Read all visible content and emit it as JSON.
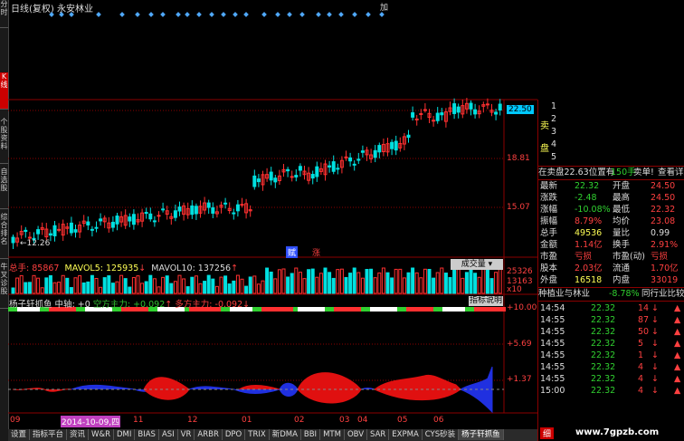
{
  "title": {
    "chart_type": "日线(复权)",
    "name": "永安林业",
    "code": ""
  },
  "topright": "加",
  "vtabs": [
    "分时",
    "K线",
    "个股资料",
    "自选股",
    "综合排名",
    "牛叉诊股"
  ],
  "price_axis": [
    "22.50",
    "18.81",
    "15.07"
  ],
  "low_label": "12.26",
  "zhang": "涨",
  "fu": "赋",
  "volume": {
    "total_label": "总手",
    "total": "85867",
    "ma5_label": "MAVOL5",
    "ma5": "125935",
    "ma10_label": "MAVOL10",
    "ma10": "137256",
    "btn": "成交量",
    "axis": [
      "25326",
      "13163",
      "x10"
    ]
  },
  "indicator": {
    "name": "杨子轩抓鱼",
    "zhongzhou_label": "中轴",
    "zhongzhou": "+0",
    "kong_label": "空方主力",
    "kong": "+0.092",
    "duo_label": "多方主力",
    "duo": "-0.092",
    "btn": "指标说明",
    "axis": [
      "+10.00",
      "+5.69",
      "+1.37"
    ]
  },
  "xaxis": [
    "09",
    "2014-10-09,四",
    "11",
    "12",
    "01",
    "02",
    "03",
    "04",
    "05",
    "06"
  ],
  "btabs": [
    "设置",
    "指标平台",
    "资讯",
    "W&R",
    "DMI",
    "BIAS",
    "ASI",
    "VR",
    "ARBR",
    "DPO",
    "TRIX",
    "新DMA",
    "BBI",
    "MTM",
    "OBV",
    "SAR",
    "EXPMA",
    "CYS砂装",
    "杨子轩抓鱼"
  ],
  "right": {
    "sell": [
      [
        "5",
        "",
        ""
      ],
      [
        "4",
        "",
        ""
      ],
      [
        "3",
        "",
        ""
      ],
      [
        "2",
        "",
        ""
      ],
      [
        "1",
        "",
        ""
      ]
    ],
    "mai": "卖",
    "pan": "盘",
    "buy": [
      [
        "1",
        "",
        ""
      ],
      [
        "2",
        "",
        ""
      ],
      [
        "3",
        "",
        ""
      ],
      [
        "4",
        "",
        ""
      ],
      [
        "5",
        "",
        ""
      ]
    ],
    "bid_info": "在卖盘22.63位置有",
    "bid_qty": "150手",
    "bid_btn": "卖单!",
    "bid_link": "查看详细",
    "stats": [
      [
        "最新",
        "22.32",
        "开盘",
        "24.50"
      ],
      [
        "涨跌",
        "-2.48",
        "最高",
        "24.50"
      ],
      [
        "涨幅",
        "-10.08%",
        "最低",
        "22.32"
      ],
      [
        "振幅",
        "8.79%",
        "均价",
        "23.08"
      ],
      [
        "总手",
        "49536",
        "量比",
        "0.99"
      ],
      [
        "金额",
        "1.14亿",
        "换手",
        "2.91%"
      ],
      [
        "市盈",
        "亏损",
        "市盈(动)",
        "亏损"
      ],
      [
        "股本",
        "2.03亿",
        "流通",
        "1.70亿"
      ],
      [
        "外盘",
        "16518",
        "内盘",
        "33019"
      ]
    ],
    "industry": "种植业与林业",
    "industry_chg": "-8.78%",
    "compare": "同行业比较",
    "ticks": [
      [
        "14:54",
        "22.32",
        "14"
      ],
      [
        "14:55",
        "22.32",
        "87"
      ],
      [
        "14:55",
        "22.32",
        "50"
      ],
      [
        "14:55",
        "22.32",
        "5"
      ],
      [
        "14:55",
        "22.32",
        "1"
      ],
      [
        "14:55",
        "22.32",
        "4"
      ],
      [
        "14:55",
        "22.32",
        "4"
      ],
      [
        "15:00",
        "22.32",
        "4"
      ]
    ],
    "tab": "细"
  },
  "watermark": "www.7gpzb.com"
}
